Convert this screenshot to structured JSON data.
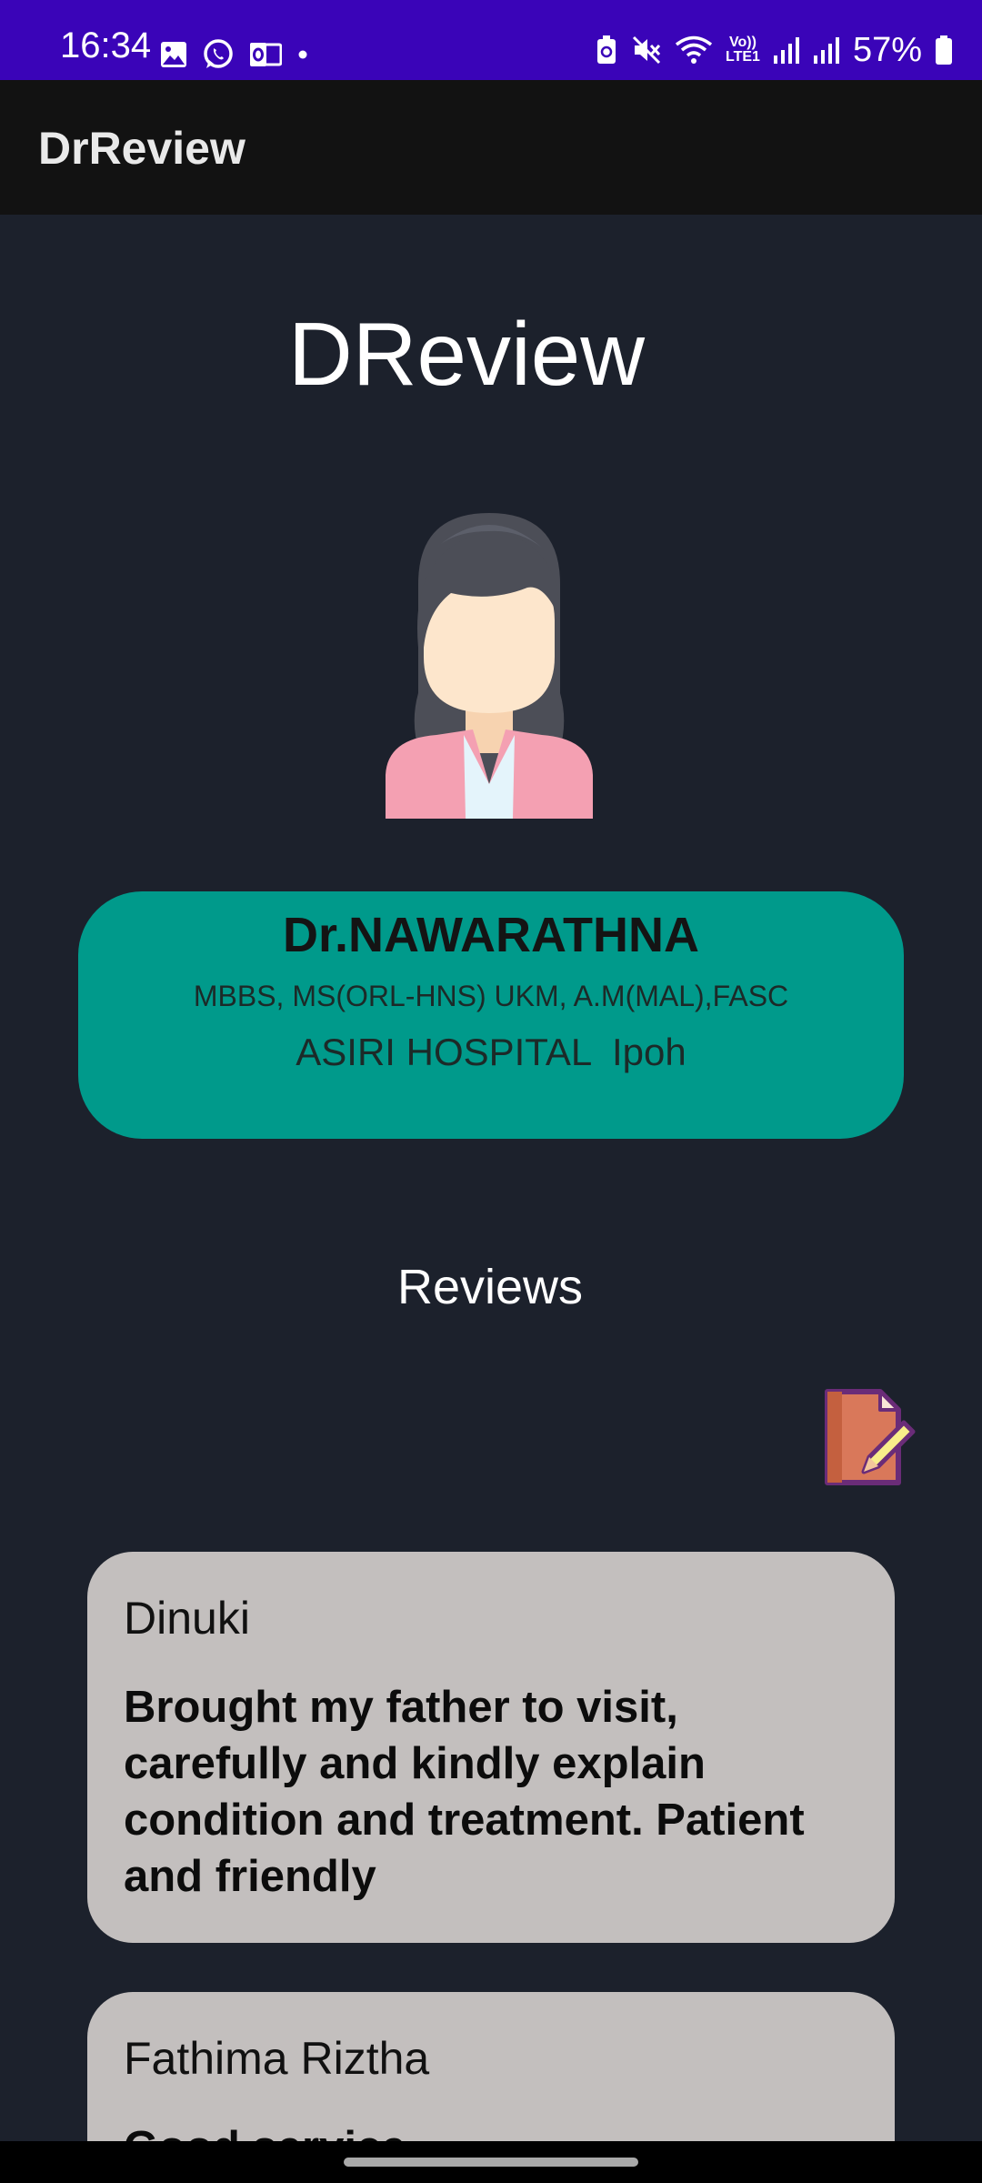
{
  "status_bar": {
    "time": "16:34",
    "left_icons": [
      "gallery-icon",
      "whatsapp-icon",
      "outlook-icon",
      "dot-icon"
    ],
    "right_icons": [
      "battery-saver-icon",
      "mute-icon",
      "wifi-icon",
      "volte-icon",
      "signal-icon",
      "signal-icon",
      "battery-icon"
    ],
    "volte_label": "Vo))",
    "lte_label": "LTE1",
    "battery_percent": "57%",
    "background": "#3a04b8"
  },
  "app_bar": {
    "title": "DrReview"
  },
  "main": {
    "brand_title": "DReview",
    "avatar_icon": "female-doctor-avatar-icon",
    "doctor": {
      "name": "Dr.NAWARATHNA",
      "qualifications": "MBBS, MS(ORL-HNS) UKM, A.M(MAL),FASC",
      "hospital": "ASIRI HOSPITAL  Ipoh",
      "card_color": "#009a8b"
    },
    "reviews_heading": "Reviews",
    "write_review_icon": "write-review-icon",
    "reviews": [
      {
        "name": "Dinuki",
        "text": "Brought my father to visit, carefully and kindly explain condition and treatment. Patient and friendly"
      },
      {
        "name": "Fathima Riztha",
        "text": "Good service"
      }
    ]
  },
  "colors": {
    "background": "#1c212c",
    "review_card": "#c3bfbe"
  }
}
